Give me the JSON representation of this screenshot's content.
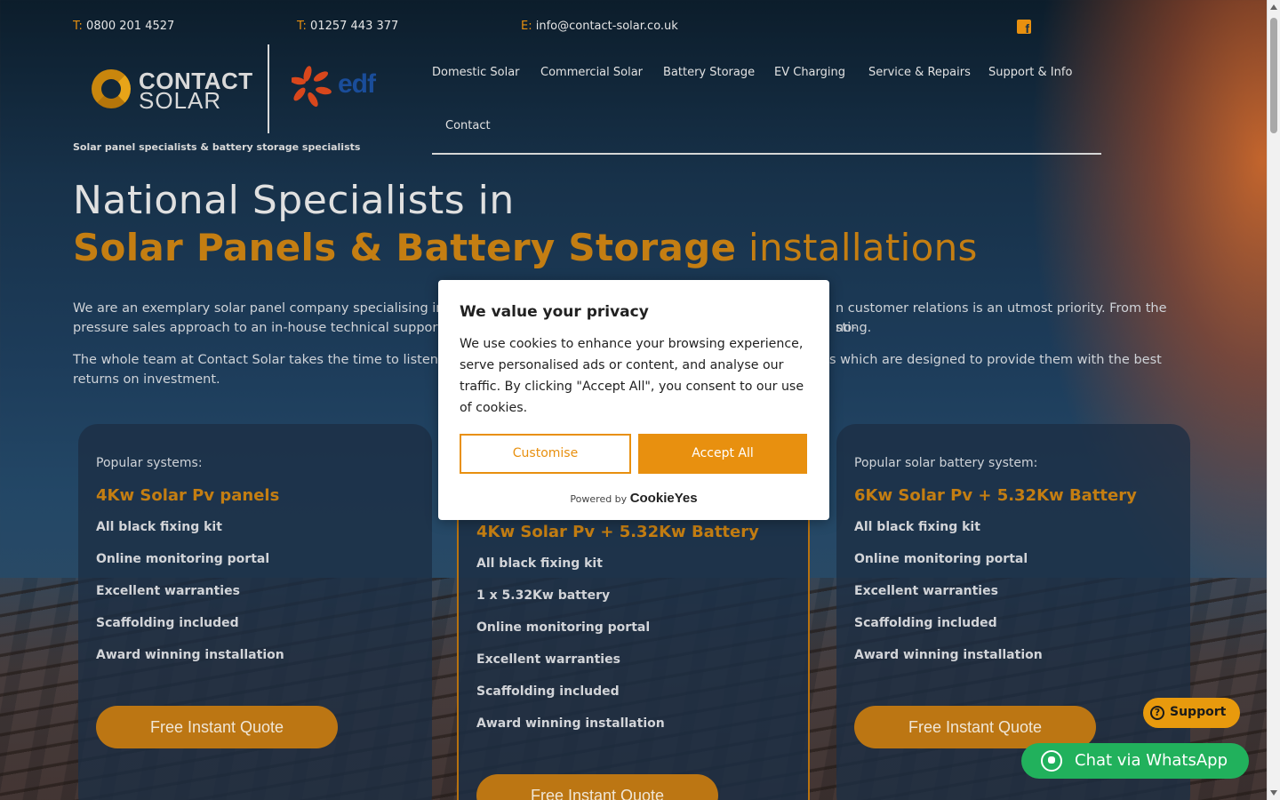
{
  "header": {
    "phone1_label": "T:",
    "phone1": "0800 201 4527",
    "phone2_label": "T:",
    "phone2": "01257 443 377",
    "email_label": "E:",
    "email": "info@contact-solar.co.uk",
    "social_icon": "facebook-icon"
  },
  "brand": {
    "logo_line1": "CONTACT",
    "logo_line2": "SOLAR",
    "partner": "edf",
    "tagline": "Solar panel specialists & battery storage specialists"
  },
  "nav": {
    "items": [
      "Domestic Solar",
      "Commercial Solar",
      "Battery Storage",
      "EV Charging",
      "Service & Repairs",
      "Support & Info",
      "Contact"
    ]
  },
  "hero": {
    "line1": "National Specialists in",
    "line2_bold": "Solar Panels & Battery Storage",
    "line2_light": "installations"
  },
  "intro": {
    "p1a": "We are an exemplary solar panel company specialising in",
    "p1b": "n customer relations is an utmost priority. From the no-",
    "p1c": "pressure sales approach to an in-house technical support",
    "p1d": "sting.",
    "p2a": "The whole team at Contact Solar takes the time to listen a",
    "p2b": "s which are designed to provide them with the best",
    "p2c": "returns on investment."
  },
  "cards": [
    {
      "popular": "Popular systems:",
      "title": "4Kw Solar Pv panels",
      "features": [
        "All black fixing kit",
        "Online monitoring portal",
        "Excellent warranties",
        "Scaffolding included",
        "Award winning installation"
      ],
      "button": "Free Instant Quote"
    },
    {
      "title": "4Kw Solar Pv + 5.32Kw Battery",
      "features": [
        "All black fixing kit",
        "1 x 5.32Kw battery",
        "Online monitoring portal",
        "Excellent warranties",
        "Scaffolding included",
        "Award winning installation"
      ],
      "button": "Free Instant Quote"
    },
    {
      "popular": "Popular solar battery system:",
      "title": "6Kw Solar Pv + 5.32Kw Battery",
      "features": [
        "All black fixing kit",
        "Online monitoring portal",
        "Excellent warranties",
        "Scaffolding included",
        "Award winning installation"
      ],
      "button": "Free Instant Quote"
    }
  ],
  "cookie": {
    "title": "We value your privacy",
    "body": "We use cookies to enhance your browsing experience, serve personalised ads or content, and analyse our traffic. By clicking \"Accept All\", you consent to our use of cookies.",
    "customise": "Customise",
    "accept": "Accept All",
    "powered_by": "Powered by",
    "brand": "CookieYes"
  },
  "widgets": {
    "support": "Support",
    "whatsapp": "Chat via WhatsApp"
  },
  "colors": {
    "accent": "#e8900f",
    "card_title": "#c47e12",
    "whatsapp": "#21b15c"
  }
}
